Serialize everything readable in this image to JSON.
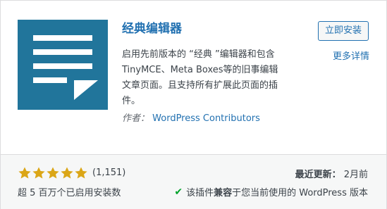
{
  "plugin": {
    "name": "经典编辑器",
    "install_label": "立即安装",
    "more_details_label": "更多详情",
    "description": "启用先前版本的 “经典 ”编辑器和包含TinyMCE、Meta Boxes等的旧事编辑文章页面。且支持所有扩展此页面的插件。",
    "author_label": "作者：",
    "author_name": "WordPress Contributors",
    "icon_color": "#21759b"
  },
  "stats": {
    "rating_stars": 5,
    "rating_max": 5,
    "rating_count": "(1,151)",
    "active_installs": "超 5 百万个已启用安装数",
    "last_updated_label": "最近更新：",
    "last_updated_value": "2月前",
    "compat_prefix": "该插件",
    "compat_bold": "兼容",
    "compat_suffix": "于您当前使用的 WordPress 版本",
    "star_color": "#dba617",
    "check_color": "#00a32a"
  }
}
